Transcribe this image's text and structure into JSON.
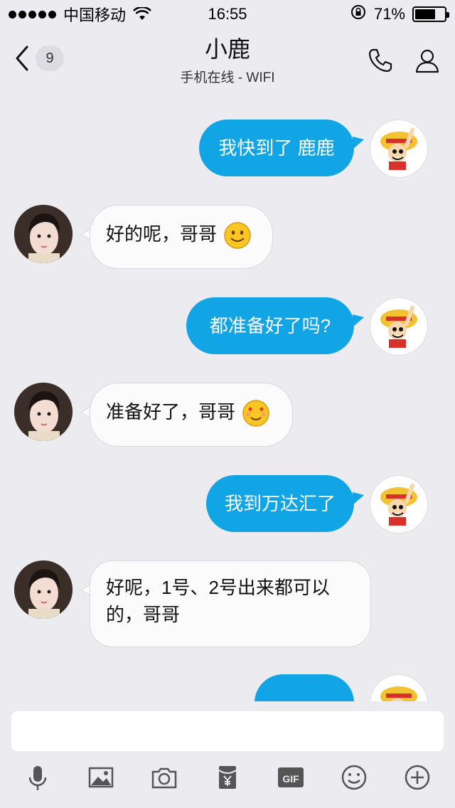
{
  "status": {
    "carrier": "中国移动",
    "time": "16:55",
    "battery": "71%",
    "battery_level": 0.71
  },
  "nav": {
    "back_count": "9",
    "title": "小鹿",
    "subtitle": "手机在线 - WIFI"
  },
  "messages": [
    {
      "from": "me",
      "text": "我快到了 鹿鹿"
    },
    {
      "from": "her",
      "text": "好的呢，哥哥",
      "emoji": "smile-emoji"
    },
    {
      "from": "me",
      "text": "都准备好了吗?"
    },
    {
      "from": "her",
      "text": "准备好了，哥哥",
      "emoji": "heart-eyes-emoji"
    },
    {
      "from": "me",
      "text": "我到万达汇了"
    },
    {
      "from": "her",
      "text_line1": "好呢，1号、2号出来都可以",
      "text_line2": "的，哥哥"
    }
  ],
  "toolbar": {
    "items": [
      "microphone-icon",
      "image-icon",
      "camera-icon",
      "red-packet-icon",
      "gif-icon",
      "emoji-icon",
      "plus-icon"
    ],
    "gif_label": "GIF"
  },
  "colors": {
    "accent": "#12a5e6",
    "background": "#ebebf0"
  }
}
